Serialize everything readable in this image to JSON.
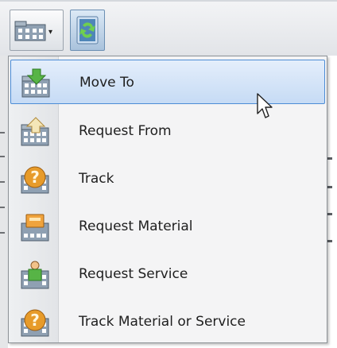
{
  "menu": {
    "items": [
      {
        "label": "Move To",
        "icon": "building-arrow-down-icon"
      },
      {
        "label": "Request From",
        "icon": "building-arrow-up-icon"
      },
      {
        "label": "Track",
        "icon": "building-question-icon"
      },
      {
        "label": "Request Material",
        "icon": "building-tag-icon"
      },
      {
        "label": "Request Service",
        "icon": "building-person-icon"
      },
      {
        "label": "Track Material or Service",
        "icon": "building-question-icon"
      }
    ],
    "hovered_index": 0
  },
  "toolbar": {
    "dropdown_icon": "building-icon",
    "refresh_icon": "refresh-icon"
  },
  "colors": {
    "hover_border": "#4c8cd6",
    "hover_fill": "#c6dbf5",
    "building_wall": "#8fa0b2",
    "arrow_green": "#57b446",
    "question_orange": "#e79b2a"
  }
}
